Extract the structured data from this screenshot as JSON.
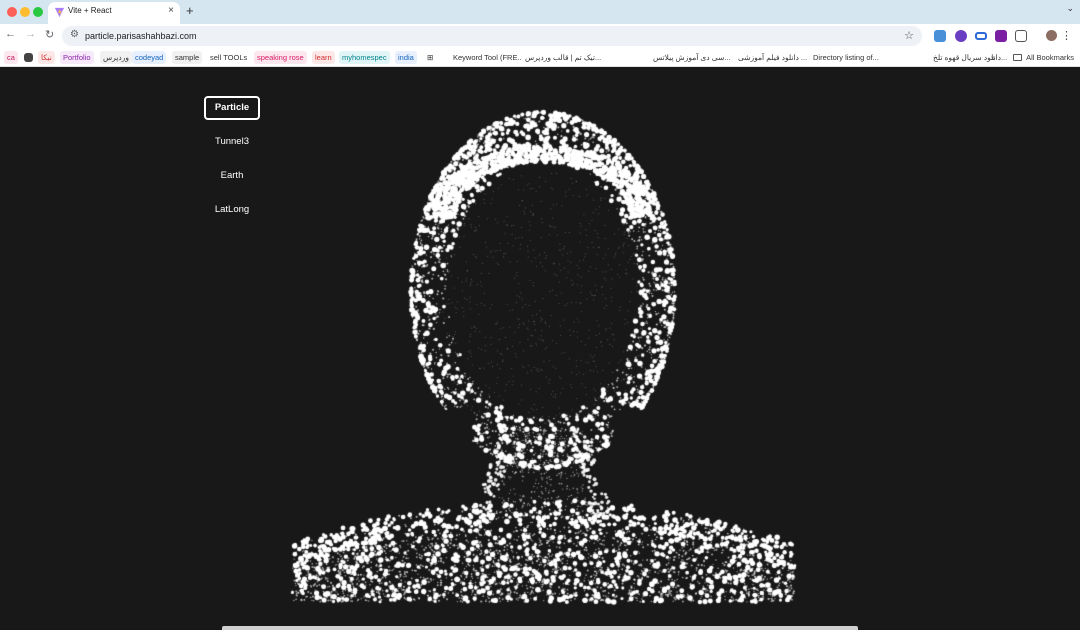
{
  "browser": {
    "tab": {
      "title": "Vite + React",
      "close": "×"
    },
    "new_tab": "+",
    "url": "particle.parisashahbazi.com",
    "bookmarks": [
      {
        "label": "ca",
        "color": "#c2185b",
        "bg": "#fde7ef"
      },
      {
        "label": "نیکا",
        "color": "#d32f2f",
        "bg": "#fde8e8"
      },
      {
        "label": "",
        "color": "#333333",
        "bg": "#ffffff",
        "icon": "app-icon"
      },
      {
        "label": "Portfolio",
        "color": "#8e24aa",
        "bg": "#f6e9fa"
      },
      {
        "label": "وردپرس",
        "color": "#333333",
        "bg": "#f1f1f1"
      },
      {
        "label": "codeyad",
        "color": "#1565c0",
        "bg": "#e7f0fc"
      },
      {
        "label": "sample",
        "color": "#333333",
        "bg": "#f1f1f1"
      },
      {
        "label": "sell TOOLs",
        "color": "#333333",
        "bg": "#ffffff"
      },
      {
        "label": "speaking rose",
        "color": "#d81b60",
        "bg": "#fde7ef"
      },
      {
        "label": "learn",
        "color": "#d32f2f",
        "bg": "#fde8e8"
      },
      {
        "label": "myhomespec",
        "color": "#00838f",
        "bg": "#e2f5f6"
      },
      {
        "label": "india",
        "color": "#1565c0",
        "bg": "#e7f0fc"
      },
      {
        "label": "Keyword Tool (FRE...",
        "color": "#333333",
        "bg": "#ffffff"
      },
      {
        "label": "تیک تم | قالب وردپرس...",
        "color": "#333333",
        "bg": "#ffffff"
      },
      {
        "label": "سی دی آموزش پیلاتس...",
        "color": "#333333",
        "bg": "#ffffff"
      },
      {
        "label": "دانلود فیلم آموزشی ... S",
        "color": "#333333",
        "bg": "#ffffff"
      },
      {
        "label": "Directory listing of...",
        "color": "#333333",
        "bg": "#ffffff"
      },
      {
        "label": "دانلود سریال قهوه تلخ...",
        "color": "#333333",
        "bg": "#ffffff"
      }
    ],
    "bookmarks_overflow": "»",
    "all_bookmarks": "All Bookmarks"
  },
  "menu": {
    "items": [
      "Particle",
      "Tunnel3",
      "Earth",
      "LatLong"
    ],
    "active": "Particle"
  },
  "colors": {
    "background": "#181818",
    "particle": "#ffffff",
    "tabbar": "#d6e6f1"
  },
  "icons": [
    "back-arrow-icon",
    "forward-arrow-icon",
    "reload-icon",
    "site-info-icon",
    "star-icon",
    "extensions-icon",
    "kebab-menu-icon",
    "particle-bust"
  ]
}
